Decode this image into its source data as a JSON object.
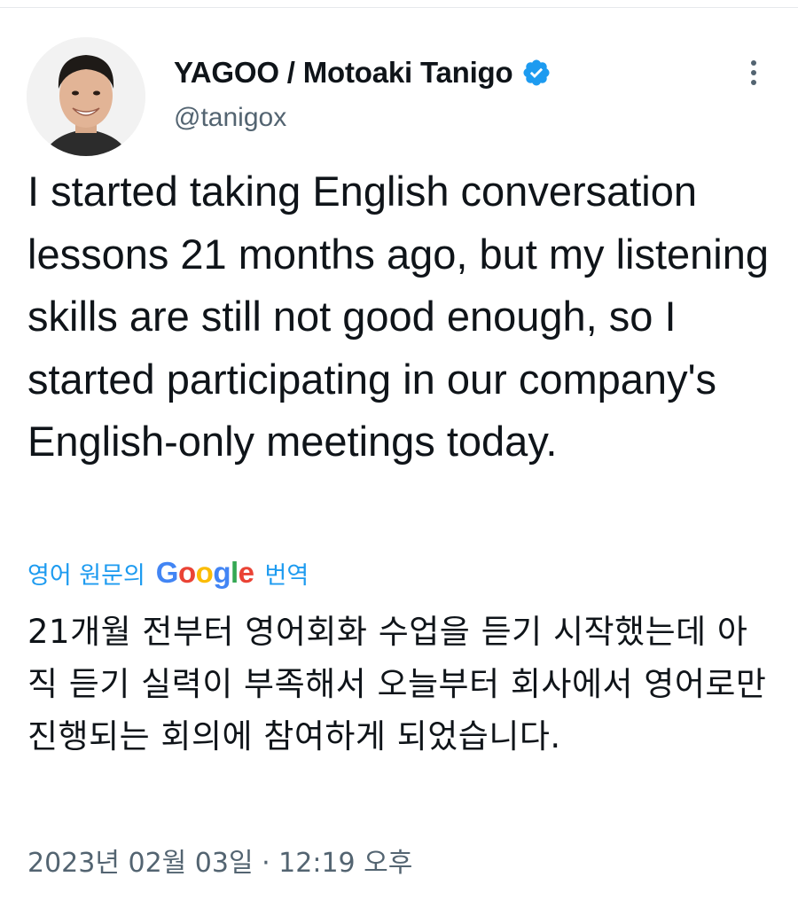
{
  "author": {
    "display_name": "YAGOO / Motoaki Tanigo",
    "handle": "@tanigox",
    "verified": true,
    "verified_color": "#1d9bf0",
    "avatar_icon": "profile-photo"
  },
  "tweet": {
    "text": "I started taking English conversation lessons 21 months ago, but my listening skills are still not good enough, so I started participating in our company's English-only meetings today.",
    "translate_prefix": "영어 원문의",
    "translate_brand": "Google",
    "translate_suffix": "번역",
    "translated_text": "21개월 전부터 영어회화 수업을 듣기 시작했는데 아직 듣기 실력이 부족해서 오늘부터 회사에서 영어로만 진행되는 회의에 참여하게 되었습니다.",
    "timestamp": "2023년 02월 03일 · 12:19 오후"
  },
  "colors": {
    "link": "#1d9bf0",
    "secondary_text": "#536471",
    "primary_text": "#0f1419"
  },
  "icons": {
    "more": "more-vertical-icon",
    "verified": "verified-badge-icon"
  }
}
